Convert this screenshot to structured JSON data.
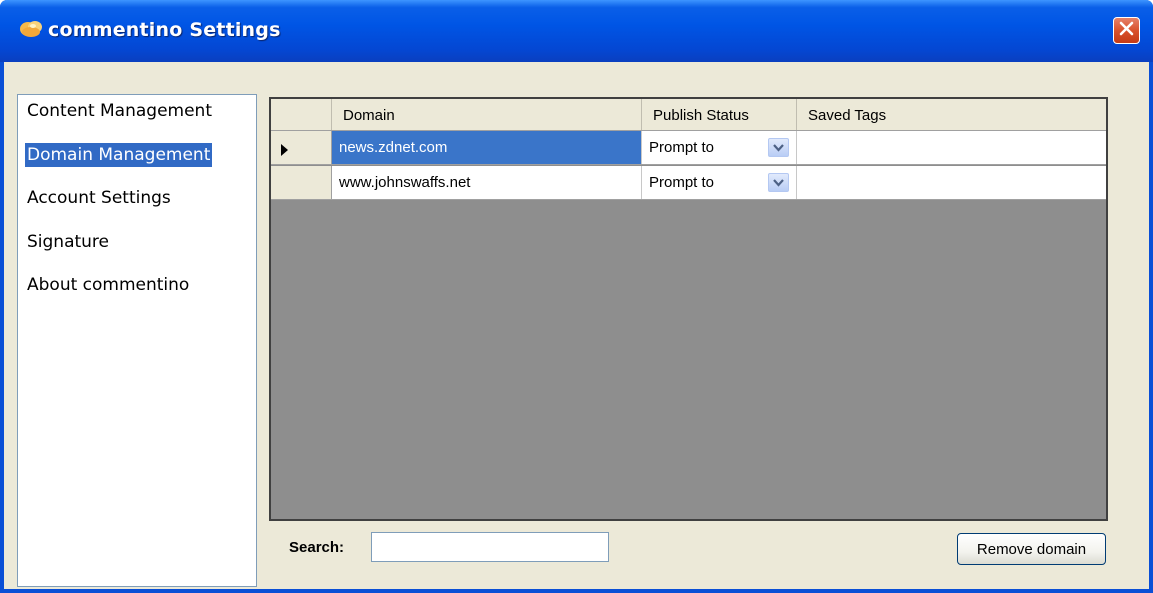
{
  "window": {
    "title": "commentino Settings"
  },
  "sidebar": {
    "items": [
      {
        "label": "Content Management",
        "selected": false
      },
      {
        "label": "Domain Management",
        "selected": true
      },
      {
        "label": "Account Settings",
        "selected": false
      },
      {
        "label": "Signature",
        "selected": false
      },
      {
        "label": "About commentino",
        "selected": false
      }
    ]
  },
  "grid": {
    "columns": [
      "Domain",
      "Publish Status",
      "Saved Tags"
    ],
    "rows": [
      {
        "domain": "news.zdnet.com",
        "publish_status": "Prompt to",
        "saved_tags": "",
        "current": true
      },
      {
        "domain": "www.johnswaffs.net",
        "publish_status": "Prompt to",
        "saved_tags": "",
        "current": false
      }
    ]
  },
  "search": {
    "label": "Search:",
    "value": ""
  },
  "buttons": {
    "remove_domain": "Remove domain"
  },
  "colors": {
    "titlebar": "#0055e5",
    "selection": "#316ac5",
    "grid_background": "#8e8e8e"
  },
  "icons": {
    "app": "commentino-cloud-icon",
    "close": "close-icon",
    "row_indicator": "current-row-arrow-icon",
    "dropdown": "chevron-down-icon"
  }
}
